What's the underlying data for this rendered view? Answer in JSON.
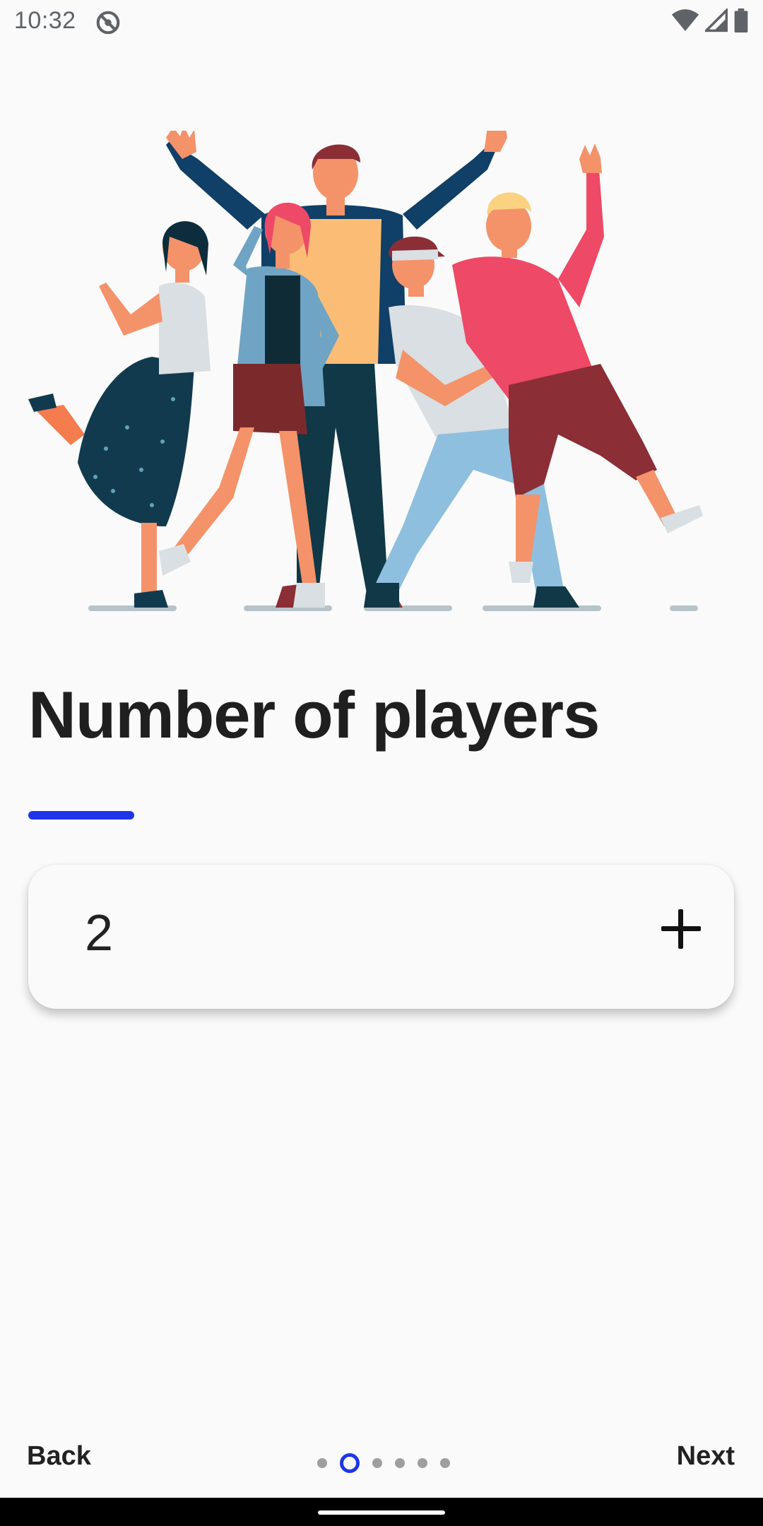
{
  "status_bar": {
    "time": "10:32",
    "icons": [
      "do-not-disturb-icon",
      "wifi-icon",
      "cellular-signal-icon",
      "battery-icon"
    ]
  },
  "illustration": {
    "description_icon": "group-of-friends-illustration"
  },
  "screen": {
    "title": "Number of players",
    "accent_color": "#1f35e8"
  },
  "counter": {
    "value": "2",
    "increment_icon": "plus-icon"
  },
  "footer": {
    "back_label": "Back",
    "next_label": "Next",
    "page_count": 6,
    "current_page": 2
  }
}
